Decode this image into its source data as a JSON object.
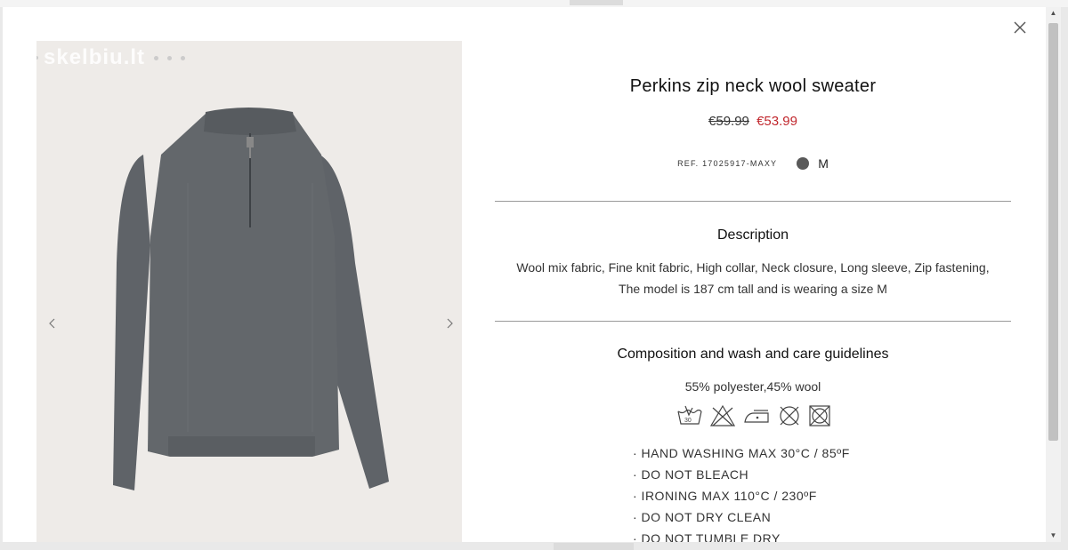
{
  "modal": {
    "close_icon": "close-icon",
    "gallery": {
      "watermark": "skelbiu.lt",
      "prev_icon": "chevron-left-icon",
      "next_icon": "chevron-right-icon"
    },
    "product": {
      "title": "Perkins zip neck wool sweater",
      "old_price": "€59.99",
      "new_price": "€53.99",
      "ref": "REF. 17025917-MAXY",
      "color_swatch": "#595959",
      "size": "M"
    },
    "description": {
      "heading": "Description",
      "text": "Wool mix fabric, Fine knit fabric, High collar, Neck closure, Long sleeve, Zip fastening, The model is 187 cm tall and is wearing a size M"
    },
    "composition": {
      "heading": "Composition and wash and care guidelines",
      "materials": "55% polyester,45% wool",
      "care_icons": [
        "hand-wash-icon",
        "no-bleach-icon",
        "iron-icon",
        "no-dry-clean-icon",
        "no-tumble-dry-icon"
      ],
      "care_items": [
        "· HAND WASHING MAX 30°C / 85ºF",
        "· DO NOT BLEACH",
        "· IRONING MAX 110°C / 230ºF",
        "· DO NOT DRY CLEAN",
        "· DO NOT TUMBLE DRY"
      ]
    }
  },
  "colors": {
    "sale_red": "#c1272d",
    "sweater_gray": "#595959"
  }
}
